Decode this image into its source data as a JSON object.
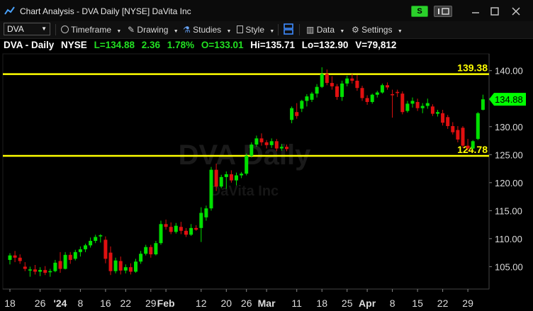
{
  "window": {
    "title": "Chart Analysis - DVA Daily [NYSE] DaVita Inc",
    "brand_button": "S"
  },
  "toolbar": {
    "symbol": "DVA",
    "timeframe": "Timeframe",
    "drawing": "Drawing",
    "studies": "Studies",
    "style": "Style",
    "data": "Data",
    "settings": "Settings"
  },
  "info": {
    "symbol": "DVA - Daily",
    "exchange": "NYSE",
    "last": "L=134.88",
    "change": "2.36",
    "pct": "1.78%",
    "open": "O=133.01",
    "high": "Hi=135.71",
    "low": "Lo=132.90",
    "volume": "V=79,812"
  },
  "colors": {
    "up": "#00e000",
    "down": "#e01010",
    "line": "#ffff00",
    "price_tag": "#00ff00",
    "bg": "#000000"
  },
  "watermark": {
    "title": "DVA Daily",
    "subtitle": "DaVita Inc"
  },
  "chart_data": {
    "type": "candlestick",
    "levels": [
      {
        "label": "139.38",
        "value": 139.38
      },
      {
        "label": "124.78",
        "value": 124.78
      }
    ],
    "last_price_label": "134.88",
    "last_price": 134.88,
    "ylim": [
      101,
      143
    ],
    "y_ticks": [
      {
        "value": 140,
        "label": "140.00"
      },
      {
        "value": 135,
        "label": "135.00"
      },
      {
        "value": 130,
        "label": "130.00"
      },
      {
        "value": 125,
        "label": "125.00"
      },
      {
        "value": 120,
        "label": "120.00"
      },
      {
        "value": 115,
        "label": "115.00"
      },
      {
        "value": 110,
        "label": "110.00"
      },
      {
        "value": 105,
        "label": "105.00"
      }
    ],
    "x_ticks": [
      {
        "label": "18",
        "index": 0,
        "bold": false
      },
      {
        "label": "26",
        "index": 6,
        "bold": false
      },
      {
        "label": "'24",
        "index": 10,
        "bold": true
      },
      {
        "label": "8",
        "index": 14,
        "bold": false
      },
      {
        "label": "16",
        "index": 19,
        "bold": false
      },
      {
        "label": "22",
        "index": 23,
        "bold": false
      },
      {
        "label": "29",
        "index": 28,
        "bold": false
      },
      {
        "label": "Feb",
        "index": 31,
        "bold": true
      },
      {
        "label": "12",
        "index": 38,
        "bold": false
      },
      {
        "label": "20",
        "index": 43,
        "bold": false
      },
      {
        "label": "26",
        "index": 47,
        "bold": false
      },
      {
        "label": "Mar",
        "index": 51,
        "bold": true
      },
      {
        "label": "11",
        "index": 57,
        "bold": false
      },
      {
        "label": "18",
        "index": 62,
        "bold": false
      },
      {
        "label": "25",
        "index": 67,
        "bold": false
      },
      {
        "label": "Apr",
        "index": 71,
        "bold": true
      },
      {
        "label": "8",
        "index": 76,
        "bold": false
      },
      {
        "label": "15",
        "index": 81,
        "bold": false
      },
      {
        "label": "22",
        "index": 86,
        "bold": false
      },
      {
        "label": "29",
        "index": 91,
        "bold": false
      }
    ],
    "candles": [
      {
        "o": 106.2,
        "h": 107.4,
        "l": 105.4,
        "c": 107.0
      },
      {
        "o": 107.0,
        "h": 107.8,
        "l": 105.8,
        "c": 106.6
      },
      {
        "o": 106.6,
        "h": 107.2,
        "l": 105.5,
        "c": 106.0
      },
      {
        "o": 105.0,
        "h": 105.8,
        "l": 104.2,
        "c": 104.6
      },
      {
        "o": 104.3,
        "h": 105.0,
        "l": 103.2,
        "c": 104.5
      },
      {
        "o": 104.5,
        "h": 105.3,
        "l": 103.6,
        "c": 104.1
      },
      {
        "o": 104.1,
        "h": 104.9,
        "l": 103.3,
        "c": 104.4
      },
      {
        "o": 104.4,
        "h": 105.1,
        "l": 103.5,
        "c": 103.9
      },
      {
        "o": 104.0,
        "h": 104.6,
        "l": 103.2,
        "c": 104.2
      },
      {
        "o": 104.2,
        "h": 106.2,
        "l": 104.0,
        "c": 105.7
      },
      {
        "o": 106.0,
        "h": 107.6,
        "l": 103.9,
        "c": 104.6
      },
      {
        "o": 104.6,
        "h": 107.6,
        "l": 104.5,
        "c": 107.1
      },
      {
        "o": 107.1,
        "h": 107.6,
        "l": 105.5,
        "c": 106.2
      },
      {
        "o": 106.4,
        "h": 108.0,
        "l": 106.1,
        "c": 107.6
      },
      {
        "o": 107.6,
        "h": 108.6,
        "l": 106.8,
        "c": 108.1
      },
      {
        "o": 108.1,
        "h": 109.1,
        "l": 107.6,
        "c": 108.8
      },
      {
        "o": 108.8,
        "h": 110.2,
        "l": 108.4,
        "c": 109.6
      },
      {
        "o": 109.6,
        "h": 110.7,
        "l": 109.2,
        "c": 110.3
      },
      {
        "o": 110.4,
        "h": 110.8,
        "l": 109.3,
        "c": 110.6
      },
      {
        "o": 109.8,
        "h": 110.4,
        "l": 105.6,
        "c": 106.4
      },
      {
        "o": 107.5,
        "h": 108.6,
        "l": 103.5,
        "c": 104.2
      },
      {
        "o": 104.2,
        "h": 106.6,
        "l": 103.8,
        "c": 106.1
      },
      {
        "o": 106.0,
        "h": 106.8,
        "l": 103.6,
        "c": 104.3
      },
      {
        "o": 104.3,
        "h": 105.4,
        "l": 103.8,
        "c": 104.9
      },
      {
        "o": 104.9,
        "h": 105.6,
        "l": 103.6,
        "c": 104.1
      },
      {
        "o": 104.1,
        "h": 106.4,
        "l": 103.9,
        "c": 105.9
      },
      {
        "o": 105.9,
        "h": 107.8,
        "l": 105.5,
        "c": 107.3
      },
      {
        "o": 107.3,
        "h": 108.9,
        "l": 107.0,
        "c": 108.5
      },
      {
        "o": 108.5,
        "h": 108.9,
        "l": 106.6,
        "c": 107.2
      },
      {
        "o": 107.2,
        "h": 109.6,
        "l": 107.0,
        "c": 109.2
      },
      {
        "o": 109.2,
        "h": 113.2,
        "l": 108.9,
        "c": 112.6
      },
      {
        "o": 112.6,
        "h": 113.4,
        "l": 111.6,
        "c": 112.1
      },
      {
        "o": 112.1,
        "h": 112.9,
        "l": 110.8,
        "c": 111.2
      },
      {
        "o": 111.2,
        "h": 112.8,
        "l": 110.9,
        "c": 112.3
      },
      {
        "o": 112.1,
        "h": 113.0,
        "l": 110.8,
        "c": 111.4
      },
      {
        "o": 111.4,
        "h": 111.9,
        "l": 110.3,
        "c": 110.7
      },
      {
        "o": 110.7,
        "h": 112.6,
        "l": 110.5,
        "c": 111.9
      },
      {
        "o": 111.9,
        "h": 112.4,
        "l": 111.4,
        "c": 111.6
      },
      {
        "o": 111.9,
        "h": 115.6,
        "l": 109.4,
        "c": 114.6
      },
      {
        "o": 113.8,
        "h": 115.9,
        "l": 113.2,
        "c": 115.4
      },
      {
        "o": 115.4,
        "h": 122.8,
        "l": 115.0,
        "c": 122.3
      },
      {
        "o": 122.3,
        "h": 123.4,
        "l": 118.5,
        "c": 119.3
      },
      {
        "o": 119.3,
        "h": 121.4,
        "l": 119.0,
        "c": 121.0
      },
      {
        "o": 121.0,
        "h": 122.0,
        "l": 118.9,
        "c": 121.5
      },
      {
        "o": 121.5,
        "h": 122.2,
        "l": 120.0,
        "c": 120.4
      },
      {
        "o": 120.4,
        "h": 121.8,
        "l": 119.5,
        "c": 121.3
      },
      {
        "o": 121.3,
        "h": 121.9,
        "l": 120.8,
        "c": 121.6
      },
      {
        "o": 121.6,
        "h": 125.2,
        "l": 121.3,
        "c": 124.8
      },
      {
        "o": 124.8,
        "h": 127.2,
        "l": 124.5,
        "c": 126.8
      },
      {
        "o": 126.8,
        "h": 128.4,
        "l": 126.4,
        "c": 127.9
      },
      {
        "o": 127.9,
        "h": 128.8,
        "l": 126.6,
        "c": 127.2
      },
      {
        "o": 127.2,
        "h": 127.6,
        "l": 126.1,
        "c": 126.7
      },
      {
        "o": 126.7,
        "h": 127.9,
        "l": 126.2,
        "c": 127.4
      },
      {
        "o": 127.4,
        "h": 127.8,
        "l": 125.6,
        "c": 126.1
      },
      {
        "o": 126.1,
        "h": 126.9,
        "l": 125.7,
        "c": 126.4
      },
      {
        "o": 126.4,
        "h": 126.8,
        "l": 125.6,
        "c": 126.0
      },
      {
        "o": 131.2,
        "h": 133.6,
        "l": 130.6,
        "c": 133.3
      },
      {
        "o": 132.6,
        "h": 134.2,
        "l": 131.4,
        "c": 131.9
      },
      {
        "o": 133.2,
        "h": 134.8,
        "l": 132.6,
        "c": 134.6
      },
      {
        "o": 134.6,
        "h": 135.8,
        "l": 133.6,
        "c": 135.4
      },
      {
        "o": 134.8,
        "h": 136.2,
        "l": 134.4,
        "c": 135.9
      },
      {
        "o": 135.9,
        "h": 137.6,
        "l": 135.2,
        "c": 137.1
      },
      {
        "o": 137.1,
        "h": 140.6,
        "l": 136.9,
        "c": 139.4
      },
      {
        "o": 139.4,
        "h": 140.2,
        "l": 137.4,
        "c": 137.8
      },
      {
        "o": 137.8,
        "h": 139.0,
        "l": 136.6,
        "c": 137.2
      },
      {
        "o": 137.2,
        "h": 137.6,
        "l": 134.8,
        "c": 135.3
      },
      {
        "o": 135.3,
        "h": 138.2,
        "l": 134.6,
        "c": 137.7
      },
      {
        "o": 137.7,
        "h": 139.1,
        "l": 137.2,
        "c": 138.6
      },
      {
        "o": 138.6,
        "h": 139.4,
        "l": 137.7,
        "c": 138.2
      },
      {
        "o": 138.2,
        "h": 139.2,
        "l": 136.4,
        "c": 136.9
      },
      {
        "o": 136.9,
        "h": 137.3,
        "l": 134.6,
        "c": 135.1
      },
      {
        "o": 135.1,
        "h": 135.6,
        "l": 133.9,
        "c": 134.4
      },
      {
        "o": 134.4,
        "h": 135.9,
        "l": 134.1,
        "c": 135.7
      },
      {
        "o": 135.7,
        "h": 136.4,
        "l": 135.2,
        "c": 136.1
      },
      {
        "o": 136.1,
        "h": 137.7,
        "l": 135.9,
        "c": 137.4
      },
      {
        "o": 137.4,
        "h": 137.9,
        "l": 136.6,
        "c": 137.0
      },
      {
        "o": 135.8,
        "h": 136.6,
        "l": 131.6,
        "c": 135.6
      },
      {
        "o": 136.2,
        "h": 136.6,
        "l": 135.3,
        "c": 136.0
      },
      {
        "o": 135.9,
        "h": 136.3,
        "l": 132.2,
        "c": 132.6
      },
      {
        "o": 132.8,
        "h": 134.6,
        "l": 132.5,
        "c": 134.1
      },
      {
        "o": 134.1,
        "h": 135.2,
        "l": 133.4,
        "c": 134.6
      },
      {
        "o": 134.4,
        "h": 135.0,
        "l": 132.8,
        "c": 133.3
      },
      {
        "o": 133.3,
        "h": 134.2,
        "l": 132.4,
        "c": 133.7
      },
      {
        "o": 133.7,
        "h": 135.0,
        "l": 133.2,
        "c": 134.2
      },
      {
        "o": 133.6,
        "h": 134.0,
        "l": 131.9,
        "c": 132.3
      },
      {
        "o": 132.3,
        "h": 133.0,
        "l": 131.8,
        "c": 132.6
      },
      {
        "o": 132.4,
        "h": 133.0,
        "l": 130.2,
        "c": 130.7
      },
      {
        "o": 131.7,
        "h": 132.1,
        "l": 129.6,
        "c": 130.1
      },
      {
        "o": 130.1,
        "h": 130.8,
        "l": 128.6,
        "c": 129.0
      },
      {
        "o": 129.4,
        "h": 130.1,
        "l": 127.2,
        "c": 127.7
      },
      {
        "o": 129.8,
        "h": 130.1,
        "l": 126.2,
        "c": 126.6
      },
      {
        "o": 126.6,
        "h": 127.8,
        "l": 125.6,
        "c": 126.1
      },
      {
        "o": 126.1,
        "h": 127.6,
        "l": 125.9,
        "c": 127.4
      },
      {
        "o": 127.8,
        "h": 132.6,
        "l": 127.6,
        "c": 132.4
      },
      {
        "o": 133.01,
        "h": 135.71,
        "l": 132.9,
        "c": 134.88
      }
    ]
  }
}
